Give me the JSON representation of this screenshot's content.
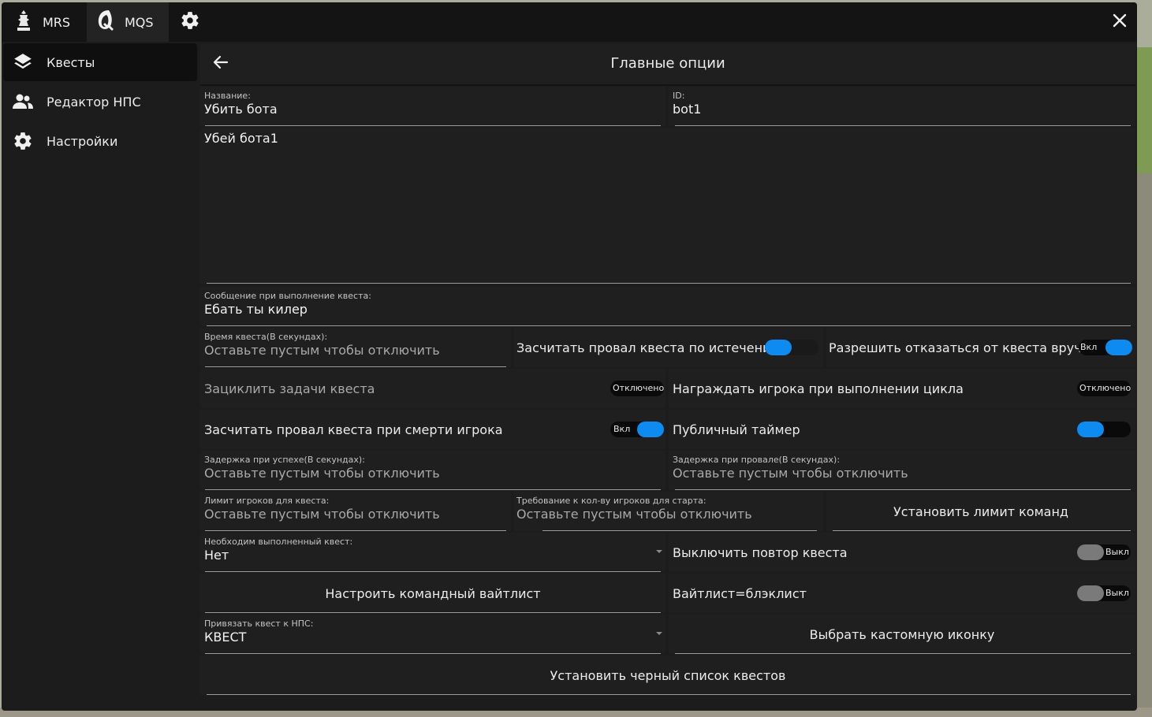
{
  "topbar": {
    "tabs": [
      {
        "label": "MRS",
        "icon": "chess-icon"
      },
      {
        "label": "MQS",
        "icon": "mqs-logo-icon"
      }
    ],
    "settings_icon": "gear-icon",
    "close_icon": "close-icon"
  },
  "sidebar": {
    "items": [
      {
        "label": "Квесты",
        "icon": "layers-icon",
        "active": true
      },
      {
        "label": "Редактор НПС",
        "icon": "users-icon",
        "active": false
      },
      {
        "label": "Настройки",
        "icon": "gear-icon",
        "active": false
      }
    ]
  },
  "header": {
    "title": "Главные опции",
    "back_icon": "back-arrow-icon"
  },
  "form": {
    "name_label": "Название:",
    "name_value": "Убить бота",
    "id_label": "ID:",
    "id_value": "bot1",
    "description": "Убей бота1",
    "complete_msg_label": "Сообщение при выполнение квеста:",
    "complete_msg_value": "Ебать ты килер",
    "time_label": "Время квеста(В секундах):",
    "time_placeholder": "Оставьте пустым чтобы отключить",
    "fail_timeout_label": "Засчитать провал квеста по истечению таймера",
    "allow_refuse_label": "Разрешить отказаться от квеста вручную",
    "allow_refuse_state": "Вкл",
    "loop_label": "Зациклить задачи квеста",
    "loop_state": "Отключено",
    "reward_cycle_label": "Награждать игрока при выполнении цикла",
    "reward_cycle_state": "Отключено",
    "fail_death_label": "Засчитать провал квеста при смерти игрока",
    "fail_death_state": "Вкл",
    "public_timer_label": "Публичный таймер",
    "success_delay_label": "Задержка при успехе(В секундах):",
    "success_delay_placeholder": "Оставьте пустым чтобы отключить",
    "fail_delay_label": "Задержка при провале(В секундах):",
    "fail_delay_placeholder": "Оставьте пустым чтобы отключить",
    "player_limit_label": "Лимит игроков для квеста:",
    "player_limit_placeholder": "Оставьте пустым чтобы отключить",
    "player_req_label": "Требование к кол-ву игроков для старта:",
    "player_req_placeholder": "Оставьте пустым чтобы отключить",
    "team_limit_button": "Установить лимит команд",
    "required_quest_label": "Необходим выполненный квест:",
    "required_quest_value": "Нет",
    "disable_repeat_label": "Выключить повтор квеста",
    "disable_repeat_state": "Выкл",
    "whitelist_button": "Настроить командный вайтлист",
    "whitelist_blacklist_label": "Вайтлист=блэклист",
    "whitelist_blacklist_state": "Выкл",
    "bind_npc_label": "Привязать квест к НПС:",
    "bind_npc_value": "КВЕСТ",
    "custom_icon_button": "Выбрать кастомную иконку",
    "blacklist_button": "Установить черный список квестов"
  },
  "colors": {
    "accent": "#0d8bf0",
    "panel": "#1f1f1f",
    "window": "#1c1c1c"
  }
}
